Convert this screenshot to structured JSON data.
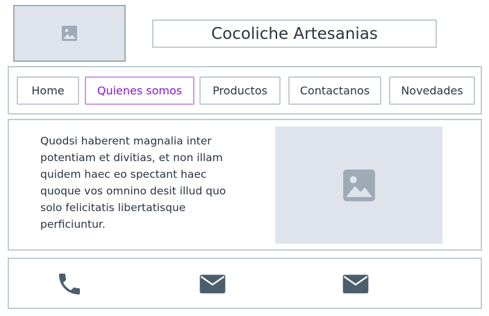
{
  "header": {
    "logo_icon": "image-placeholder-icon",
    "title": "Cocoliche Artesanias"
  },
  "nav": {
    "items": [
      {
        "label": "Home"
      },
      {
        "label": "Quienes somos",
        "active": true
      },
      {
        "label": "Productos"
      },
      {
        "label": "Contactanos"
      },
      {
        "label": "Novedades"
      }
    ]
  },
  "main": {
    "text": "Quodsi haberent magnalia inter potentiam et divitias, et non illam quidem haec eo spectant haec quoque vos omnino desit illud quo solo felicitatis libertatisque perficiuntur.",
    "image_icon": "image-placeholder-icon"
  },
  "footer": {
    "icons": [
      "phone-icon",
      "mail-icon",
      "mail-icon"
    ]
  },
  "colors": {
    "accent": "#8a18c6",
    "accent_border": "#cf9ae0",
    "placeholder_bg": "#dfe4ec",
    "icon": "#4c5d6b"
  }
}
